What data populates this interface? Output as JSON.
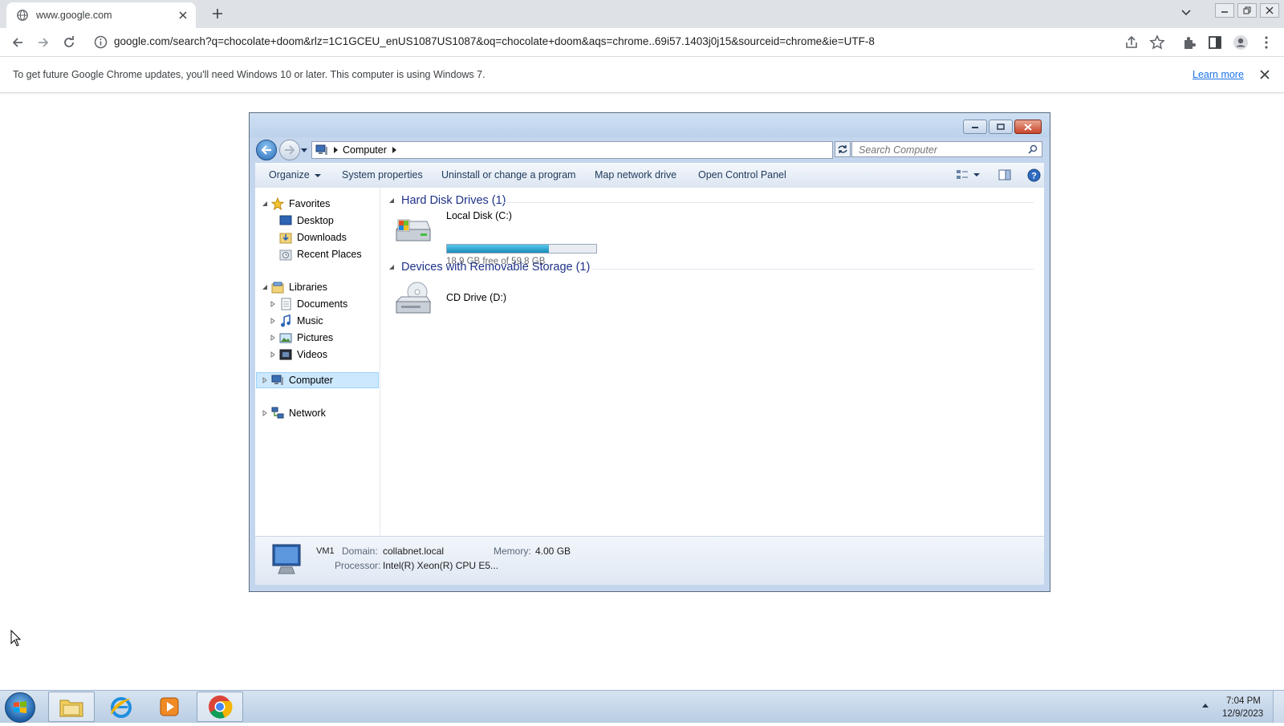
{
  "browser": {
    "tab": {
      "title": "www.google.com",
      "favicon": "globe-icon"
    },
    "url": "google.com/search?q=chocolate+doom&rlz=1C1GCEU_enUS1087US1087&oq=chocolate+doom&aqs=chrome..69i57.1403j0j15&sourceid=chrome&ie=UTF-8",
    "infobar": {
      "message": "To get future Google Chrome updates, you'll need Windows 10 or later. This computer is using Windows 7.",
      "link": "Learn more"
    }
  },
  "explorer": {
    "breadcrumb": "Computer",
    "search_placeholder": "Search Computer",
    "commands": {
      "organize": "Organize",
      "system_properties": "System properties",
      "uninstall": "Uninstall or change a program",
      "map_drive": "Map network drive",
      "control_panel": "Open Control Panel"
    },
    "nav": {
      "favorites": "Favorites",
      "desktop": "Desktop",
      "downloads": "Downloads",
      "recent": "Recent Places",
      "libraries": "Libraries",
      "documents": "Documents",
      "music": "Music",
      "pictures": "Pictures",
      "videos": "Videos",
      "computer": "Computer",
      "network": "Network"
    },
    "groups": {
      "hdd": "Hard Disk Drives (1)",
      "removable": "Devices with Removable Storage (1)"
    },
    "drives": {
      "c": {
        "name": "Local Disk (C:)",
        "free_text": "18.9 GB free of 59.8 GB",
        "used_fraction": 0.684
      },
      "d": {
        "name": "CD Drive (D:)"
      }
    },
    "details": {
      "name": "VM1",
      "domain_label": "Domain:",
      "domain": "collabnet.local",
      "memory_label": "Memory:",
      "memory": "4.00 GB",
      "processor_label": "Processor:",
      "processor": "Intel(R) Xeon(R) CPU E5..."
    }
  },
  "taskbar": {
    "time": "7:04 PM",
    "date": "12/9/2023",
    "apps": [
      "windows-explorer",
      "internet-explorer",
      "media-player",
      "google-chrome"
    ]
  },
  "colors": {
    "accent": "#1a73e8",
    "drive_fill": "#1a8bb8",
    "explorer_frame": "#c3d6ed"
  }
}
